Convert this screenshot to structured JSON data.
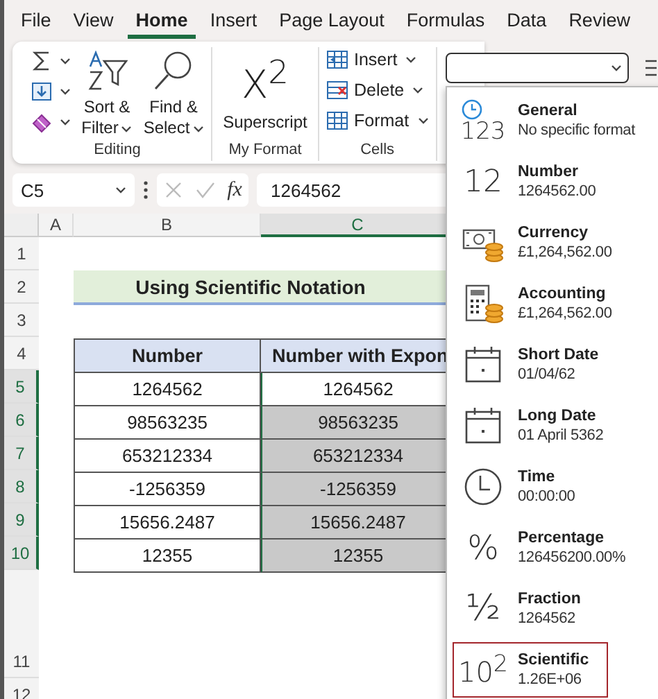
{
  "menu_tabs": [
    {
      "label": "File",
      "selected": false
    },
    {
      "label": "View",
      "selected": false
    },
    {
      "label": "Home",
      "selected": true
    },
    {
      "label": "Insert",
      "selected": false
    },
    {
      "label": "Page Layout",
      "selected": false
    },
    {
      "label": "Formulas",
      "selected": false
    },
    {
      "label": "Data",
      "selected": false
    },
    {
      "label": "Review",
      "selected": false
    }
  ],
  "ribbon_groups": [
    {
      "kind": "editing",
      "label": "Editing",
      "buttons": [
        {
          "kind": "sort-filter",
          "label": "Sort & Filter"
        },
        {
          "kind": "find-select",
          "label": "Find & Select"
        }
      ]
    },
    {
      "kind": "single",
      "label": "My Format",
      "buttons": [
        {
          "kind": "superscript",
          "icon_text": "X$^{2}$",
          "label": "Superscript"
        }
      ]
    },
    {
      "kind": "cells",
      "label": "Cells",
      "buttons": [
        {
          "kind": "insert",
          "label": "Insert"
        },
        {
          "kind": "delete",
          "label": "Delete"
        },
        {
          "kind": "format",
          "label": "Format"
        }
      ]
    }
  ],
  "formula_bar": {
    "name_box": "C5",
    "function_label": "fx",
    "value": "1264562"
  },
  "sheet": {
    "columns": [
      {
        "label": "A",
        "selected": false
      },
      {
        "label": "B",
        "selected": false
      },
      {
        "label": "C",
        "selected": true
      }
    ],
    "row_headers": [
      {
        "label": "1",
        "selected": false
      },
      {
        "label": "2",
        "selected": false
      },
      {
        "label": "3",
        "selected": false
      },
      {
        "label": "4",
        "selected": false
      },
      {
        "label": "5",
        "selected": true
      },
      {
        "label": "6",
        "selected": true
      },
      {
        "label": "7",
        "selected": true
      },
      {
        "label": "8",
        "selected": true
      },
      {
        "label": "9",
        "selected": true
      },
      {
        "label": "10",
        "selected": true
      },
      {
        "label": "11",
        "selected": false
      },
      {
        "label": "12",
        "selected": false
      }
    ],
    "title": "Using Scientific Notation",
    "table_columns": [
      "Number",
      "Number with Expon"
    ],
    "table_rows": [
      {
        "cells": [
          "1264562",
          "1264562"
        ],
        "selected": true,
        "active": true
      },
      {
        "cells": [
          "98563235",
          "98563235"
        ],
        "selected": true,
        "active": false
      },
      {
        "cells": [
          "653212334",
          "653212334"
        ],
        "selected": true,
        "active": false
      },
      {
        "cells": [
          "-1256359",
          "-1256359"
        ],
        "selected": true,
        "active": false
      },
      {
        "cells": [
          "15656.2487",
          "15656.2487"
        ],
        "selected": true,
        "active": false
      },
      {
        "cells": [
          "12355",
          "12355"
        ],
        "selected": true,
        "active": false
      }
    ]
  },
  "number_format": {
    "expanded": true,
    "items": [
      {
        "kind": "general",
        "icon_text": "123",
        "name": "General",
        "sample": "No specific format",
        "selected": false
      },
      {
        "kind": "number",
        "icon_text": "12",
        "name": "Number",
        "sample": "1264562.00",
        "selected": false
      },
      {
        "kind": "currency",
        "name": "Currency",
        "sample": "£1,264,562.00",
        "selected": false
      },
      {
        "kind": "accounting",
        "name": "Accounting",
        "sample": "£1,264,562.00",
        "selected": false
      },
      {
        "kind": "short-date",
        "name": "Short Date",
        "sample": "01/04/62",
        "selected": false
      },
      {
        "kind": "long-date",
        "name": "Long Date",
        "sample": "01 April 5362",
        "selected": false
      },
      {
        "kind": "time",
        "name": "Time",
        "sample": "00:00:00",
        "selected": false
      },
      {
        "kind": "percentage",
        "icon_text": "%",
        "name": "Percentage",
        "sample": "126456200.00%",
        "selected": false
      },
      {
        "kind": "fraction",
        "icon_text": "½",
        "name": "Fraction",
        "sample": "1264562",
        "selected": false
      },
      {
        "kind": "scientific",
        "icon_text": "10$^{2}$",
        "name": "Scientific",
        "sample": "1.26E+06",
        "selected": true
      }
    ]
  }
}
